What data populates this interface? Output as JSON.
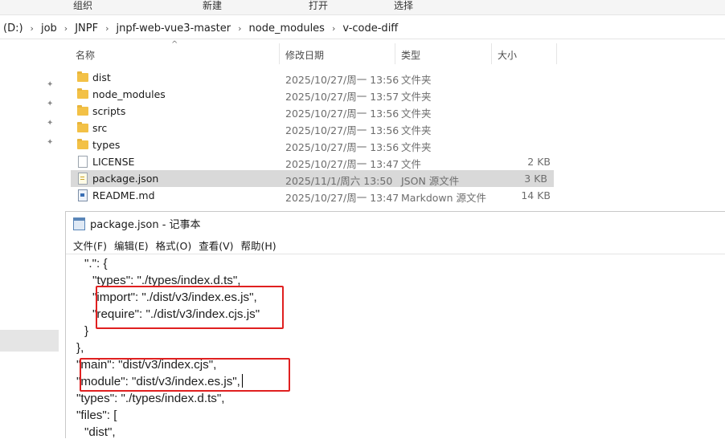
{
  "ribbon": {
    "groups": [
      "组织",
      "新建",
      "打开",
      "选择"
    ]
  },
  "address": {
    "crumbs": [
      "(D:)",
      "job",
      "JNPF",
      "jnpf-web-vue3-master",
      "node_modules",
      "v-code-diff"
    ]
  },
  "columns": {
    "name": "名称",
    "date": "修改日期",
    "type": "类型",
    "size": "大小"
  },
  "files": [
    {
      "name": "dist",
      "date": "2025/10/27/周一 13:56",
      "type": "文件夹",
      "size": "",
      "icon": "folder-icon"
    },
    {
      "name": "node_modules",
      "date": "2025/10/27/周一 13:57",
      "type": "文件夹",
      "size": "",
      "icon": "folder-icon"
    },
    {
      "name": "scripts",
      "date": "2025/10/27/周一 13:56",
      "type": "文件夹",
      "size": "",
      "icon": "folder-icon"
    },
    {
      "name": "src",
      "date": "2025/10/27/周一 13:56",
      "type": "文件夹",
      "size": "",
      "icon": "folder-icon"
    },
    {
      "name": "types",
      "date": "2025/10/27/周一 13:56",
      "type": "文件夹",
      "size": "",
      "icon": "folder-icon"
    },
    {
      "name": "LICENSE",
      "date": "2025/10/27/周一 13:47",
      "type": "文件",
      "size": "2 KB",
      "icon": "file-icon"
    },
    {
      "name": "package.json",
      "date": "2025/11/1/周六 13:50",
      "type": "JSON 源文件",
      "size": "3 KB",
      "icon": "json-file-icon"
    },
    {
      "name": "README.md",
      "date": "2025/10/27/周一 13:47",
      "type": "Markdown 源文件",
      "size": "14 KB",
      "icon": "markdown-file-icon"
    }
  ],
  "notepad": {
    "title": "package.json - 记事本",
    "menu": [
      "文件(F)",
      "编辑(E)",
      "格式(O)",
      "查看(V)",
      "帮助(H)"
    ],
    "lines": [
      "\".\": {",
      "\"types\": \"./types/index.d.ts\",",
      "\"import\": \"./dist/v3/index.es.js\",",
      "\"require\": \"./dist/v3/index.cjs.js\"",
      "}",
      "},",
      "\"main\": \"dist/v3/index.cjs\",",
      "\"module\": \"dist/v3/index.es.js\",",
      "\"types\": \"./types/index.d.ts\",",
      "\"files\": [",
      "\"dist\","
    ]
  }
}
